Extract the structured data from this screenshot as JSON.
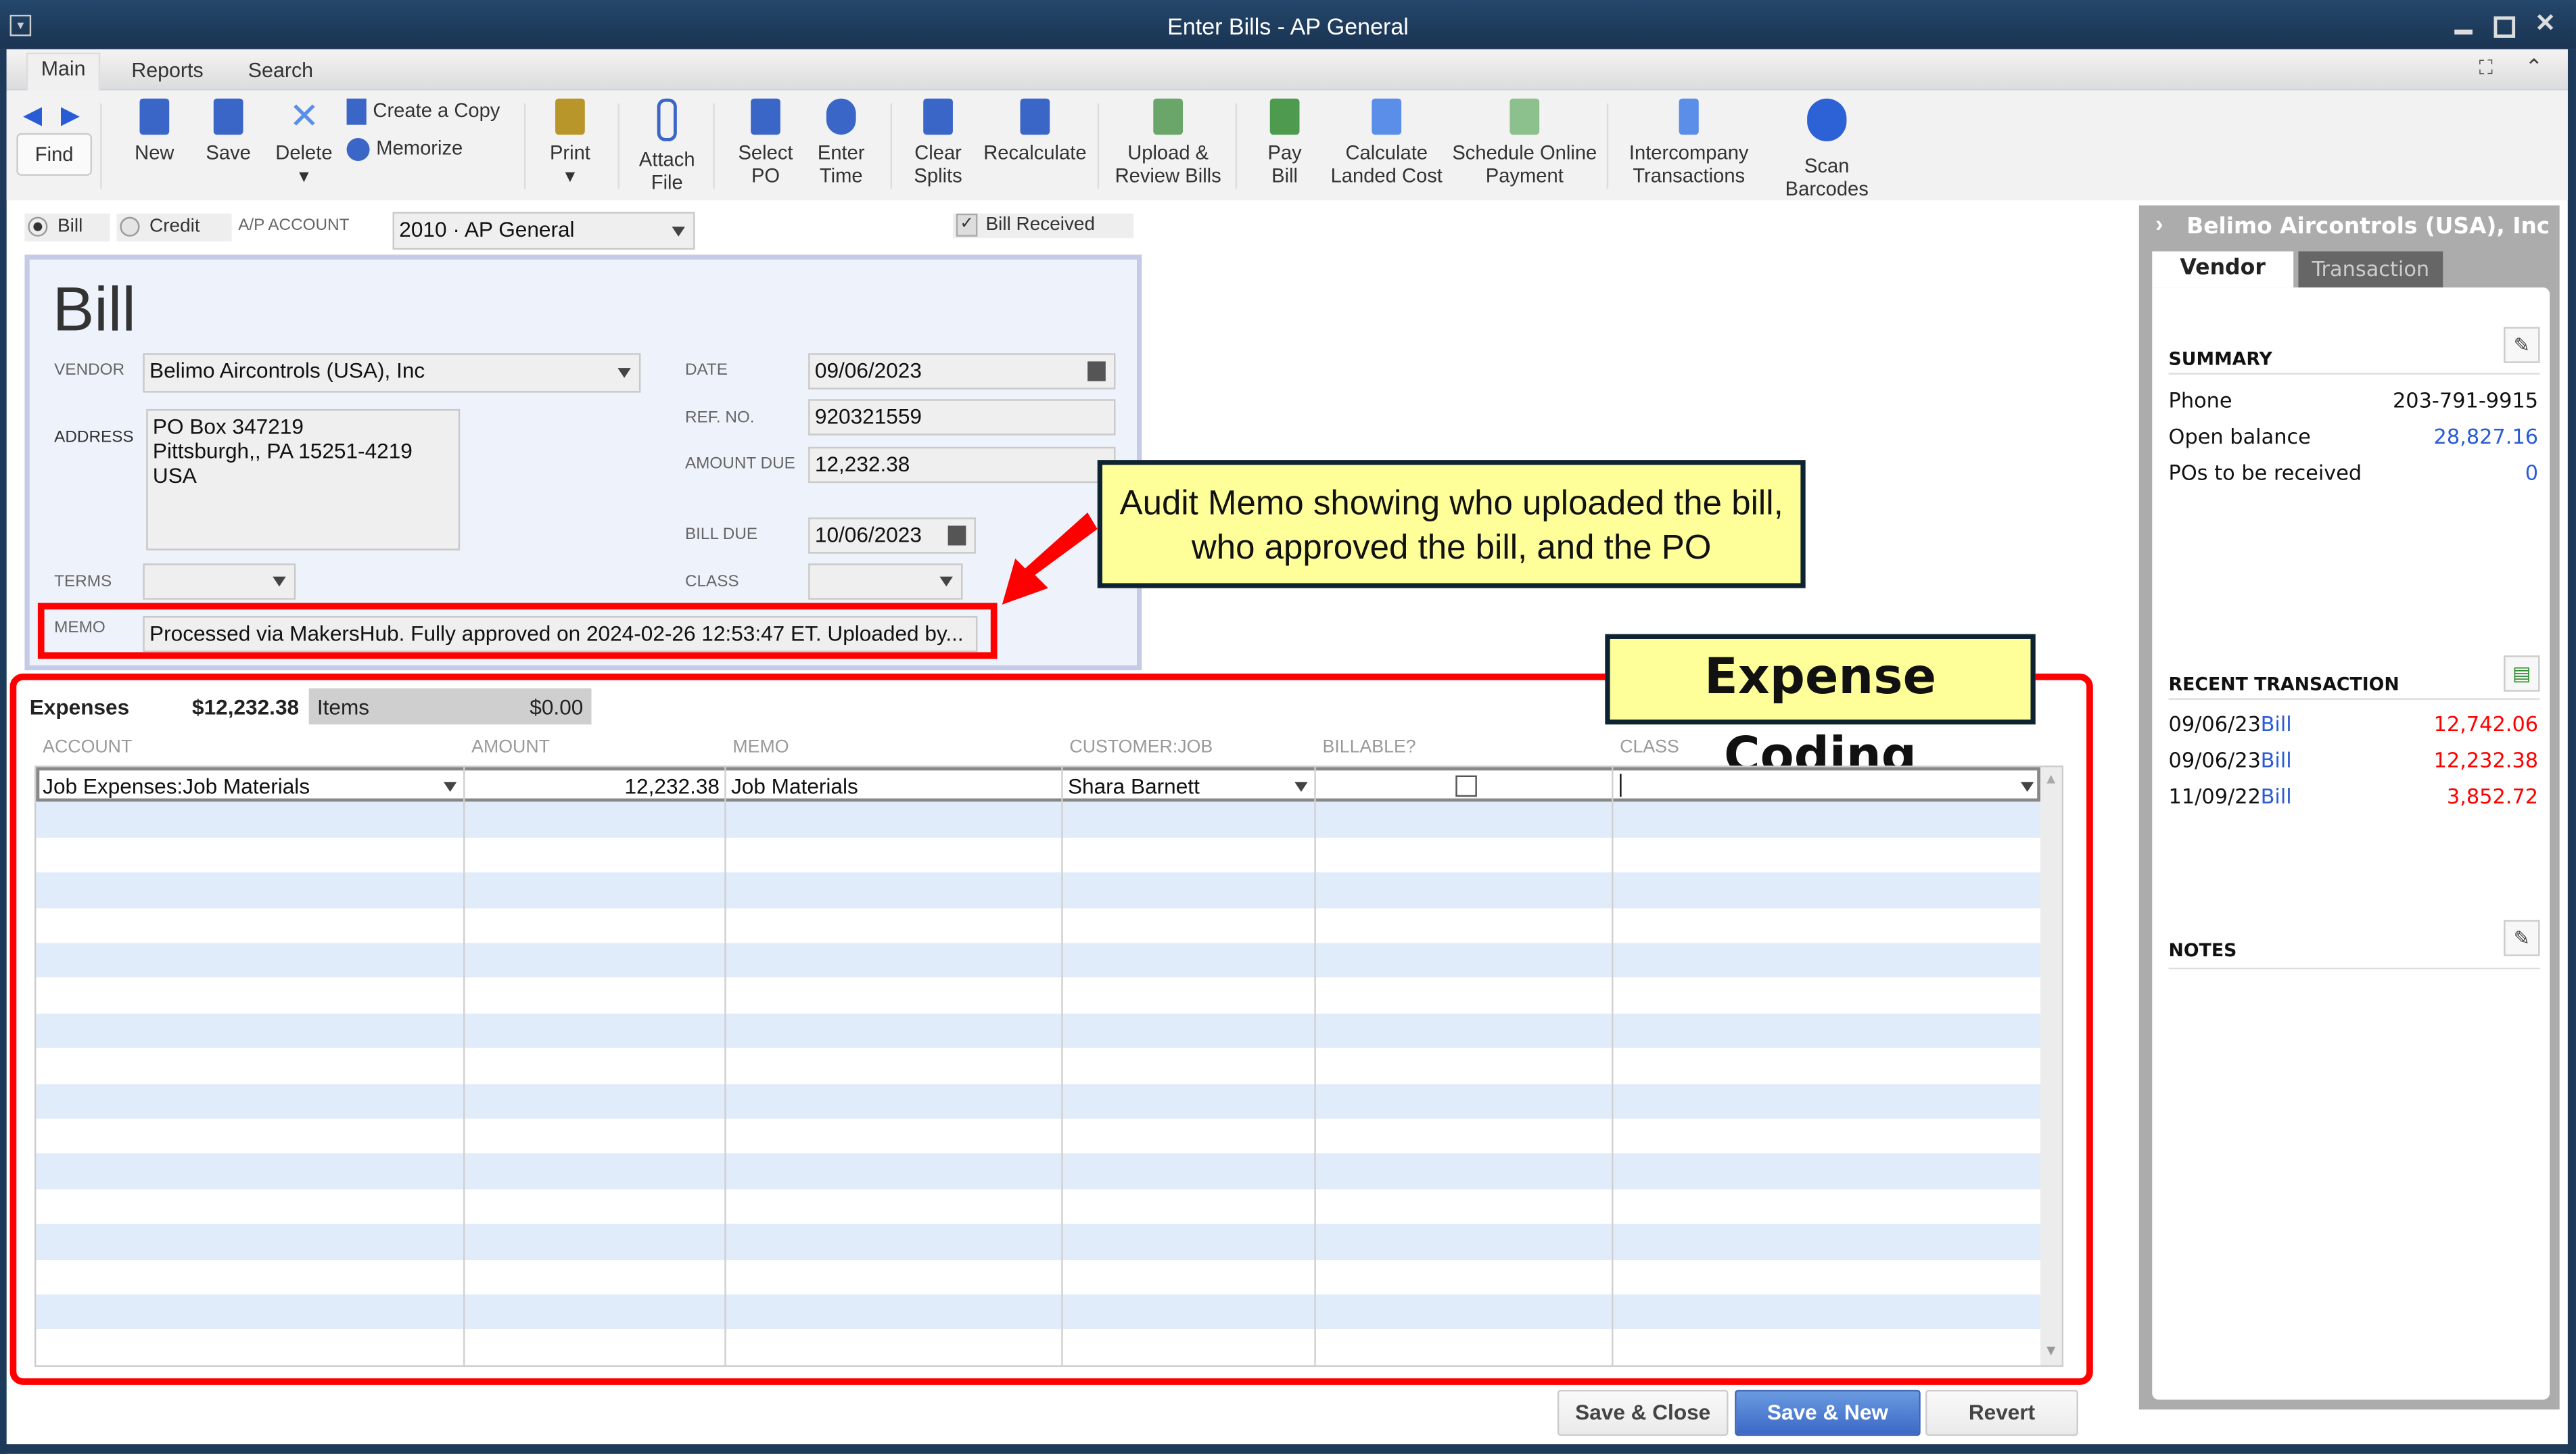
{
  "window": {
    "title": "Enter Bills - AP General"
  },
  "ribbon_tabs": [
    {
      "label": "Main",
      "selected": true
    },
    {
      "label": "Reports"
    },
    {
      "label": "Search"
    }
  ],
  "toolbar": {
    "find": "Find",
    "new": "New",
    "save": "Save",
    "delete": "Delete",
    "create_copy": "Create a Copy",
    "memorize": "Memorize",
    "print": "Print",
    "attach1": "Attach",
    "attach2": "File",
    "selectpo1": "Select",
    "selectpo2": "PO",
    "entertime1": "Enter",
    "entertime2": "Time",
    "clear1": "Clear",
    "clear2": "Splits",
    "recalculate": "Recalculate",
    "upload1": "Upload &",
    "upload2": "Review Bills",
    "pay1": "Pay",
    "pay2": "Bill",
    "calc1": "Calculate",
    "calc2": "Landed Cost",
    "sched1": "Schedule Online",
    "sched2": "Payment",
    "inter1": "Intercompany",
    "inter2": "Transactions",
    "scan1": "Scan",
    "scan2": "Barcodes"
  },
  "form": {
    "bill_radio": "Bill",
    "credit_radio": "Credit",
    "bill_selected": true,
    "ap_account_label": "A/P ACCOUNT",
    "ap_account": "2010 · AP General",
    "bill_received_label": "Bill Received",
    "bill_received": true,
    "heading": "Bill",
    "vendor_label": "VENDOR",
    "vendor": "Belimo Aircontrols (USA), Inc",
    "address_label": "ADDRESS",
    "address": [
      "PO Box 347219",
      "Pittsburgh,, PA 15251-4219",
      "USA"
    ],
    "date_label": "DATE",
    "date": "09/06/2023",
    "ref_label": "REF. NO.",
    "ref": "920321559",
    "amount_due_label": "AMOUNT DUE",
    "amount_due": "12,232.38",
    "bill_due_label": "BILL DUE",
    "bill_due": "10/06/2023",
    "terms_label": "TERMS",
    "terms": "",
    "class_label": "CLASS",
    "class": "",
    "memo_label": "MEMO",
    "memo": "Processed via MakersHub. Fully approved on 2024-02-26 12:53:47 ET. Uploaded by..."
  },
  "annotations": {
    "audit": "Audit Memo showing who uploaded the bill, who approved the bill, and the PO",
    "expense": "Expense Coding",
    "highlight_color": "#ff0000"
  },
  "expenses": {
    "tab_label": "Expenses",
    "tab_amount": "$12,232.38",
    "items_label": "Items",
    "items_amount": "$0.00",
    "columns": [
      "ACCOUNT",
      "AMOUNT",
      "MEMO",
      "CUSTOMER:JOB",
      "BILLABLE?",
      "CLASS"
    ],
    "rows": [
      {
        "account": "Job Expenses:Job Materials",
        "amount": "12,232.38",
        "memo": "Job Materials",
        "customer_job": "Shara Barnett",
        "billable": false,
        "class": ""
      }
    ]
  },
  "buttons": {
    "save_close": "Save & Close",
    "save_new": "Save & New",
    "revert": "Revert"
  },
  "sidebar": {
    "vendor_name": "Belimo Aircontrols (USA), Inc",
    "tab_vendor": "Vendor",
    "tab_transaction": "Transaction",
    "summary_title": "SUMMARY",
    "summary": [
      {
        "label": "Phone",
        "value": "203-791-9915"
      },
      {
        "label": "Open balance",
        "value": "28,827.16"
      },
      {
        "label": "POs to be received",
        "value": "0"
      }
    ],
    "recent_title": "RECENT TRANSACTION",
    "recent": [
      {
        "date": "09/06/23",
        "type": "Bill",
        "amount": "12,742.06"
      },
      {
        "date": "09/06/23",
        "type": "Bill",
        "amount": "12,232.38"
      },
      {
        "date": "11/09/22",
        "type": "Bill",
        "amount": "3,852.72"
      }
    ],
    "notes_title": "NOTES"
  }
}
